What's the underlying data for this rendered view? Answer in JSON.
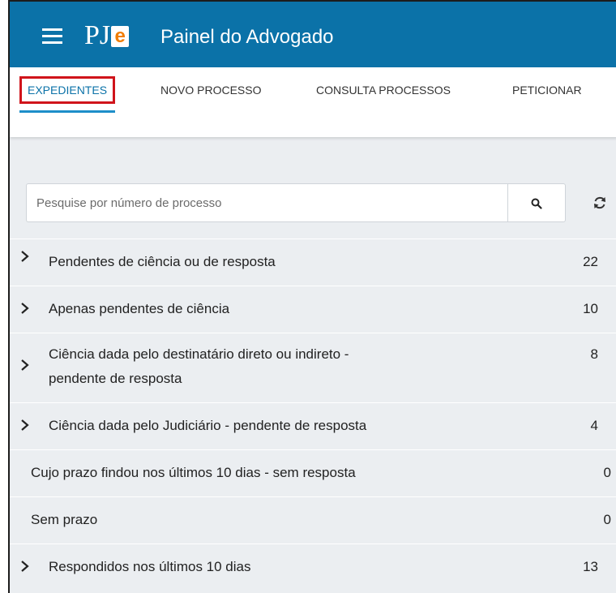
{
  "header": {
    "logo_text": "PJe",
    "title": "Painel do Advogado",
    "menu_icon": "hamburger-icon",
    "brand_color": "#0b72a8"
  },
  "tabs": [
    {
      "label": "EXPEDIENTES",
      "active": true
    },
    {
      "label": "NOVO PROCESSO",
      "active": false
    },
    {
      "label": "CONSULTA PROCESSOS",
      "active": false
    },
    {
      "label": "PETICIONAR",
      "active": false
    }
  ],
  "search": {
    "placeholder": "Pesquise por número de processo",
    "value": "",
    "button_icon": "search-icon",
    "refresh_icon": "refresh-icon"
  },
  "list": [
    {
      "label": "Pendentes de ciência ou de resposta",
      "count": "22",
      "expandable": true
    },
    {
      "label": "Apenas pendentes de ciência",
      "count": "10",
      "expandable": true
    },
    {
      "label": "Ciência dada pelo destinatário direto ou indireto -",
      "label2": "pendente de resposta",
      "count": "8",
      "expandable": true
    },
    {
      "label": "Ciência dada pelo Judiciário - pendente de resposta",
      "count": "4",
      "expandable": true
    },
    {
      "label": "Cujo prazo findou nos últimos 10 dias - sem resposta",
      "count": "0",
      "expandable": false
    },
    {
      "label": "Sem prazo",
      "count": "0",
      "expandable": false
    },
    {
      "label": "Respondidos nos últimos 10 dias",
      "count": "13",
      "expandable": true
    }
  ]
}
